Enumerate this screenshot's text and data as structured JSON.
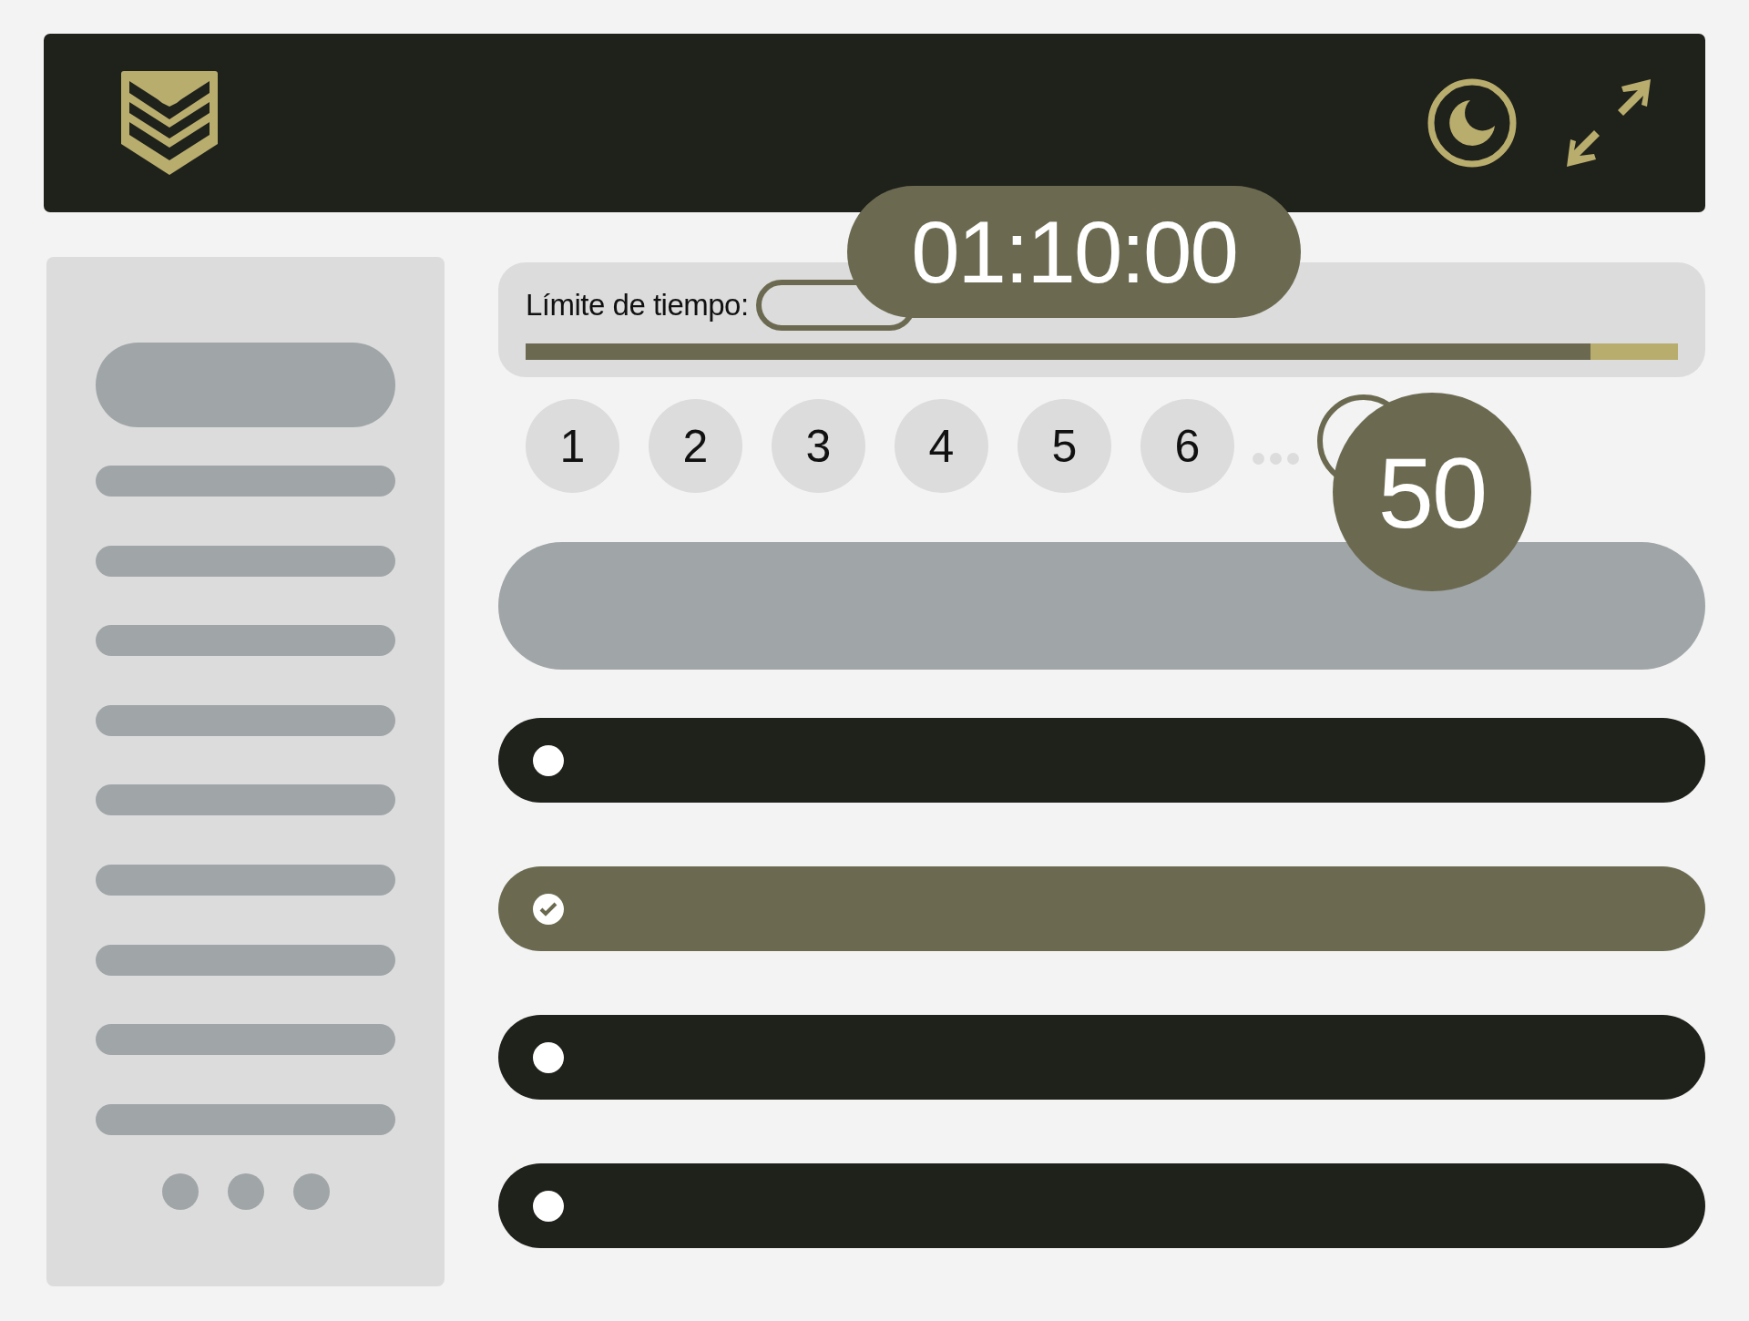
{
  "timer": {
    "label": "Límite de tiempo:",
    "time": "01:10:00",
    "level": 0.924
  },
  "questions": [
    {
      "label": "1",
      "selected": false
    },
    {
      "label": "2",
      "selected": false
    },
    {
      "label": "3",
      "selected": false
    },
    {
      "label": "4",
      "selected": false
    },
    {
      "label": "5",
      "selected": false
    },
    {
      "label": "6",
      "selected": false
    }
  ],
  "current_question": "50",
  "options": [
    {
      "selected": false
    },
    {
      "selected": true
    },
    {
      "selected": false
    },
    {
      "selected": false
    }
  ]
}
